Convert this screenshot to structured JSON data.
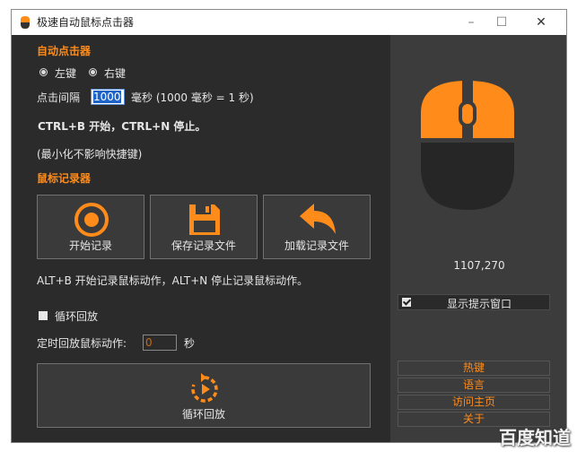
{
  "window": {
    "title": "极速自动鼠标点击器",
    "controls": {
      "minimize": "–",
      "maximize": "☐",
      "close": "✕"
    }
  },
  "auto_click": {
    "section_title": "自动点击器",
    "left_key_label": "左键",
    "right_key_label": "右键",
    "selected_button": "左键",
    "interval_label": "点击间隔",
    "interval_value": "1000",
    "interval_unit": "毫秒 (1000 毫秒 = 1 秒)",
    "hotkey_hint": "CTRL+B 开始，CTRL+N 停止。",
    "minimize_hint": "(最小化不影响快捷键)"
  },
  "recorder": {
    "section_title": "鼠标记录器",
    "buttons": [
      {
        "label": "开始记录",
        "icon": "record-icon"
      },
      {
        "label": "保存记录文件",
        "icon": "save-icon"
      },
      {
        "label": "加载记录文件",
        "icon": "load-icon"
      }
    ],
    "hotkey_hint": "ALT+B 开始记录鼠标动作，ALT+N 停止记录鼠标动作。",
    "loop_label": "循环回放",
    "timed_label": "定时回放鼠标动作:",
    "timed_value": "0",
    "timed_unit": "秒",
    "replay_label": "循环回放"
  },
  "side": {
    "coordinates": "1107,270",
    "show_tip_label": "显示提示窗口",
    "show_tip_checked": true,
    "links": [
      "热键",
      "语言",
      "访问主页",
      "关于"
    ]
  },
  "colors": {
    "accent": "#ff8c1a",
    "panel": "#2b2b2b",
    "side_panel": "#3c3c3c"
  },
  "watermark": "百度知道"
}
